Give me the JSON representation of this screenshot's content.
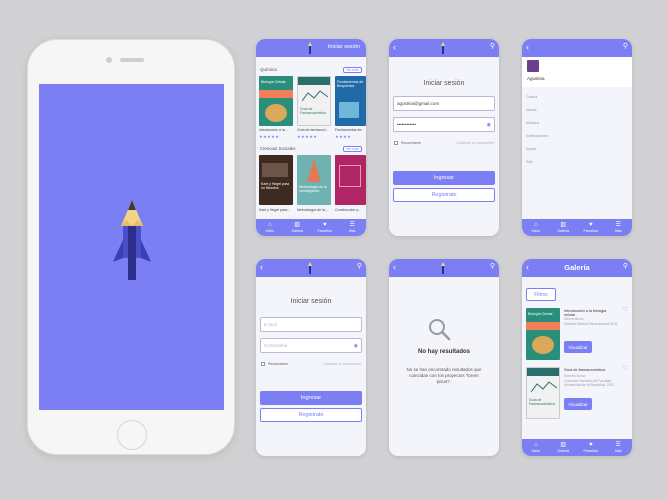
{
  "splash": {
    "logo_icon": "pencil-rocket-icon"
  },
  "screen_home": {
    "topbar_link": "Iniciar sesión",
    "section1": {
      "title": "Química",
      "more": "Ver más"
    },
    "books1": [
      {
        "title": "Introducción a la...",
        "cover": "Biología Celular"
      },
      {
        "title": "Guía de farmacoci...",
        "cover": "Guía de Farmacocinética"
      },
      {
        "title": "Fundamentos de...",
        "cover": "Fundamentos de Bioquímica"
      }
    ],
    "section2": {
      "title": "Ciencias Sociales",
      "more": "Ver más"
    },
    "books2": [
      {
        "title": "Kant y Hegel para...",
        "cover": "Kant y Hegel para no filósofos"
      },
      {
        "title": "Metodología de la...",
        "cover": "Metodología de la Investigación"
      },
      {
        "title": "Construcción y...",
        "cover": ""
      }
    ]
  },
  "tabs": [
    "Inicio",
    "Galería",
    "Favoritos",
    "Más"
  ],
  "login_filled": {
    "title": "Iniciar sesión",
    "email": "agustina@gmail.com",
    "password": "••••••••••••",
    "remember": "Recuérdame",
    "forgot": "Olvidaste tu contraseña?",
    "login_btn": "Ingresar",
    "register_btn": "Registrate"
  },
  "menu": {
    "user": "Agustina",
    "items": [
      "Cuenta",
      "Idioma",
      "Afiliados",
      "Notificaciones",
      "Ayuda",
      "Salir"
    ]
  },
  "login_empty": {
    "title": "Iniciar sesión",
    "email_ph": "E-mail",
    "password_ph": "Contraseña",
    "remember": "Recuérdame",
    "forgot": "Olvidaste tu contraseña?",
    "login_btn": "Ingresar",
    "register_btn": "Registrate"
  },
  "no_results": {
    "title": "No hay resultados",
    "message": "No se han encontrado resultados que coincidan con los proyectos \"lorem ipsum\"."
  },
  "gallery": {
    "title": "Galería",
    "filter": "Filtros",
    "items": [
      {
        "title": "Introducción a la biología celular",
        "author": "Alberts Bruce",
        "publisher": "Editorial Médica Panamericana 2011",
        "button": "Visualizar",
        "cover": "Biología Celular"
      },
      {
        "title": "Guía de farmacocinética",
        "author": "Roberto Dorso",
        "publisher": "Colección Servicios de Facultad, Universidad de la República, 2012",
        "button": "Visualizar",
        "cover": "Guía de Farmacocinética"
      }
    ]
  },
  "colors": {
    "primary": "#7b7ff3",
    "background": "#d1d1d3",
    "card": "#f4f4fb"
  }
}
